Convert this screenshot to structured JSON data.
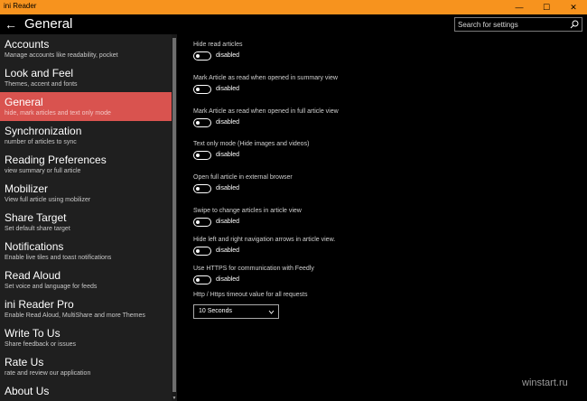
{
  "window": {
    "title": "ini Reader",
    "controls": [
      "minimize-icon",
      "maximize-icon",
      "close-icon"
    ]
  },
  "header": {
    "back_icon": "back-arrow-icon",
    "title": "General",
    "search_placeholder": "Search for settings",
    "search_icon": "search-icon"
  },
  "sidebar": {
    "items": [
      {
        "title": "Accounts",
        "subtitle": "Manage accounts like readability, pocket"
      },
      {
        "title": "Look and Feel",
        "subtitle": "Themes, accent and fonts"
      },
      {
        "title": "General",
        "subtitle": "hide, mark articles and text only mode"
      },
      {
        "title": "Synchronization",
        "subtitle": "number of articles to sync"
      },
      {
        "title": "Reading Preferences",
        "subtitle": "view summary or full article"
      },
      {
        "title": "Mobilizer",
        "subtitle": "View full article using mobilizer"
      },
      {
        "title": "Share Target",
        "subtitle": "Set default share target"
      },
      {
        "title": "Notifications",
        "subtitle": "Enable live tiles and toast notifications"
      },
      {
        "title": "Read Aloud",
        "subtitle": "Set voice and language for feeds"
      },
      {
        "title": "ini Reader Pro",
        "subtitle": "Enable Read Aloud, MultiShare and more Themes"
      },
      {
        "title": "Write To Us",
        "subtitle": "Share feedback or issues"
      },
      {
        "title": "Rate Us",
        "subtitle": "rate and review our application"
      },
      {
        "title": "About Us",
        "subtitle": ""
      }
    ],
    "selected_index": 2
  },
  "settings": [
    {
      "label": "Hide read articles",
      "state": "disabled",
      "on": false
    },
    {
      "label": "Mark Article as read when opened in summary view",
      "state": "disabled",
      "on": false
    },
    {
      "label": "Mark Article as read when opened in full article view",
      "state": "disabled",
      "on": false
    },
    {
      "label": "Text only mode (Hide images and videos)",
      "state": "disabled",
      "on": false
    },
    {
      "label": "Open full article in external browser",
      "state": "disabled",
      "on": false
    },
    {
      "label": "Swipe to change articles in article view",
      "state": "disabled",
      "on": false
    },
    {
      "label": "Hide left and right navigation arrows in article view.",
      "state": "disabled",
      "on": false
    },
    {
      "label": "Use HTTPS for communication with Feedly",
      "state": "disabled",
      "on": false
    }
  ],
  "timeout": {
    "label": "Http / Https timeout value for all requests",
    "selected": "10 Seconds",
    "chevron_icon": "chevron-down-icon"
  },
  "watermark": "winstart.ru",
  "colors": {
    "titlebar": "#f7931e",
    "selected_item": "#d9534f",
    "sidebar_bg": "#1f1f1f",
    "content_bg": "#000000"
  }
}
